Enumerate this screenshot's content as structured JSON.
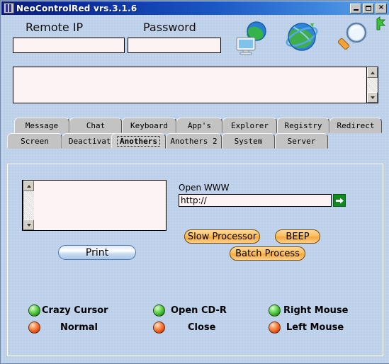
{
  "window": {
    "title": "NeoControlRed vrs.3.1.6",
    "icon": "app-icon",
    "minimize_label": "",
    "maximize_label": "",
    "close_label": "×"
  },
  "header": {
    "remote_ip_label": "Remote IP",
    "remote_ip_value": "",
    "remote_ip_placeholder": "",
    "password_label": "Password",
    "password_value": "",
    "password_placeholder": "",
    "icons": [
      {
        "name": "network-connect-icon"
      },
      {
        "name": "globe-icon"
      },
      {
        "name": "magnifier-icon"
      }
    ],
    "corner_flag": "green-flag-icon"
  },
  "log": {
    "value": "",
    "scroll_up": "▲",
    "scroll_down": "▼"
  },
  "tabs": {
    "row1": [
      {
        "label": "Message",
        "selected": false
      },
      {
        "label": "Chat",
        "selected": false
      },
      {
        "label": "Keyboard",
        "selected": false
      },
      {
        "label": "App's",
        "selected": false
      },
      {
        "label": "Explorer",
        "selected": false
      },
      {
        "label": "Registry",
        "selected": false
      },
      {
        "label": "Redirect",
        "selected": false
      }
    ],
    "row2": [
      {
        "label": "Screen",
        "selected": false
      },
      {
        "label": "Deactivate",
        "selected": false
      },
      {
        "label": "Anothers",
        "selected": true
      },
      {
        "label": "Anothers 2",
        "selected": false
      },
      {
        "label": "System",
        "selected": false
      },
      {
        "label": "Server",
        "selected": false
      }
    ]
  },
  "panel": {
    "list_value": "",
    "print_label": "Print",
    "www_label": "Open WWW",
    "www_value": "http://",
    "www_placeholder": "http://",
    "go_label": "➜",
    "buttons": [
      {
        "label": "Slow Processor"
      },
      {
        "label": "BEEP"
      },
      {
        "label": "Batch Process"
      }
    ],
    "leds": [
      {
        "on_label": "Crazy Cursor",
        "off_label": "Normal"
      },
      {
        "on_label": "Open CD-R",
        "off_label": "Close"
      },
      {
        "on_label": "Right Mouse",
        "off_label": "Left Mouse"
      }
    ]
  },
  "colors": {
    "background": "#bcd0ea",
    "title_start": "#0a1c7a",
    "title_end": "#62a6ea",
    "field": "#fdf2f4",
    "orange_button": "#f5a93f",
    "led_green": "#36b02a",
    "led_red": "#f15a1e",
    "go_green": "#0f8a1e"
  }
}
